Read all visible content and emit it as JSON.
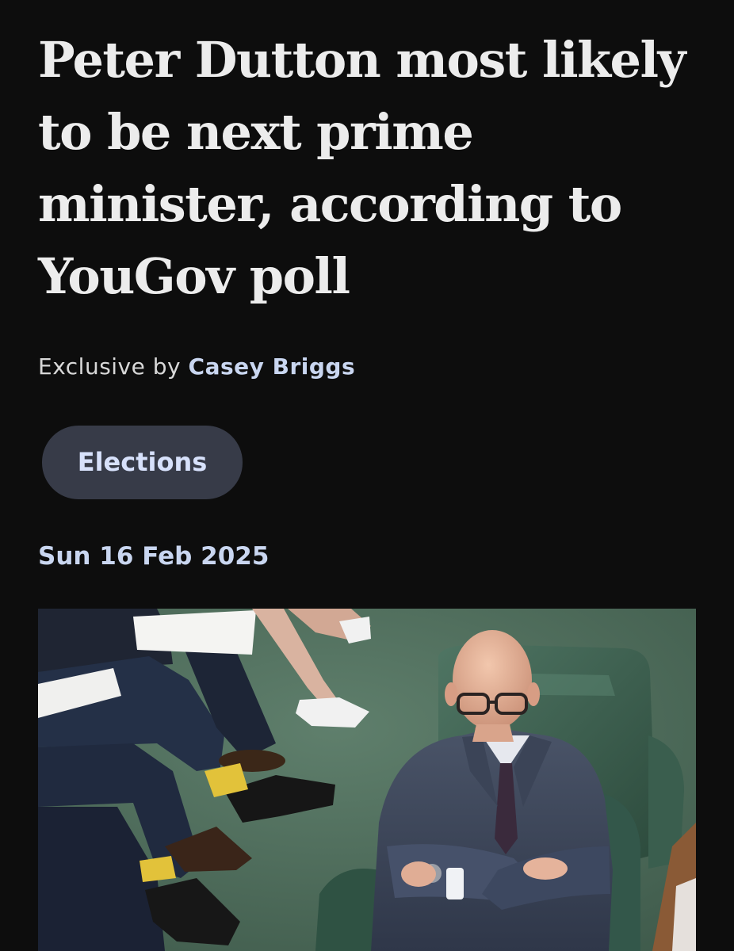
{
  "article": {
    "headline": "Peter Dutton most likely to be next prime minister, according to YouGov poll",
    "byline_prefix": "Exclusive by",
    "author": "Casey Briggs",
    "tag": "Elections",
    "date": "Sun 16 Feb 2025"
  },
  "hero_image": {
    "alt": "Peter Dutton sitting in a green leather chair in parliament with arms crossed, smiling up at the camera"
  },
  "colors": {
    "background": "#0d0d0d",
    "headline": "#ececec",
    "author_link": "#c9d6f0",
    "chip_background": "#373b48",
    "chip_text": "#d7e1fb"
  }
}
